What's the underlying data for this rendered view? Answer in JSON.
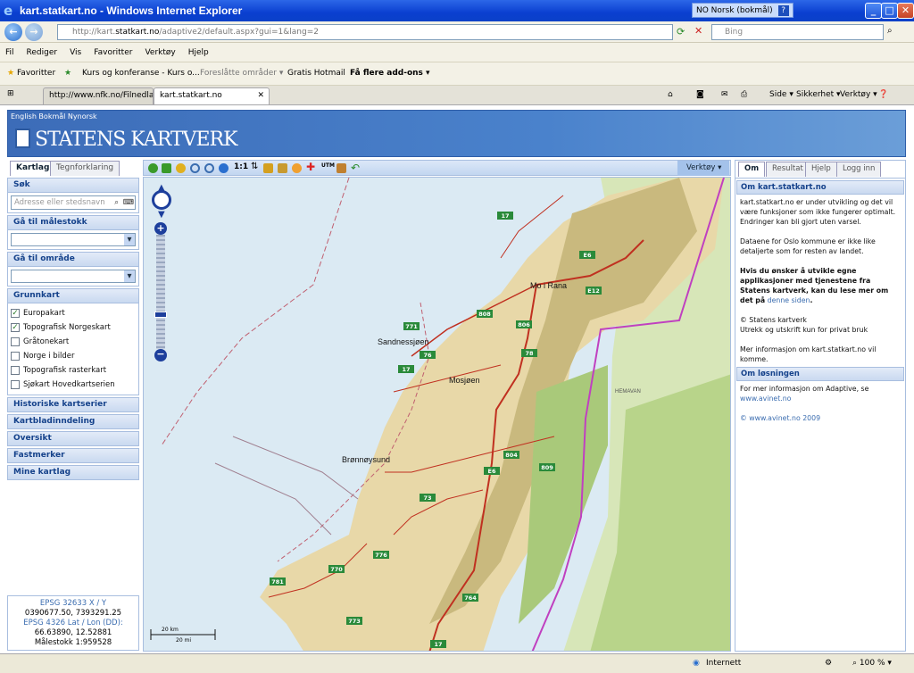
{
  "window": {
    "title_prefix": "kart.statkart.no",
    "title_suffix": "- Windows Internet Explorer",
    "language_indicator": "NO Norsk (bokmål)"
  },
  "address": {
    "url_prefix": "http://kart.",
    "url_domain": "statkart.no",
    "url_path": "/adaptive2/default.aspx?gui=1&lang=2",
    "search_placeholder": "Bing"
  },
  "menu": [
    "Fil",
    "Rediger",
    "Vis",
    "Favoritter",
    "Verktøy",
    "Hjelp"
  ],
  "favorites": {
    "favorites_label": "Favoritter",
    "items": [
      "Kurs og konferanse - Kurs o...",
      "Foreslåtte områder ▾",
      "Gratis Hotmail",
      "Få flere add-ons ▾"
    ]
  },
  "tabs": {
    "tab1": "http://www.nfk.no/Filnedlast...",
    "tab2": "kart.statkart.no",
    "tools": [
      "Side ▾",
      "Sikkerhet ▾",
      "Verktøy ▾"
    ]
  },
  "header": {
    "languages": "English Bokmål Nynorsk",
    "brand": "STATENS KARTVERK"
  },
  "left": {
    "tab_active": "Kartlag",
    "tab_other": "Tegnforklaring",
    "search_title": "Søk",
    "search_placeholder": "Adresse eller stedsnavn",
    "scale_title": "Gå til målestokk",
    "area_title": "Gå til område",
    "basemap_title": "Grunnkart",
    "layers": [
      {
        "label": "Europakart",
        "checked": "✓"
      },
      {
        "label": "Topografisk Norgeskart",
        "checked": "✓"
      },
      {
        "label": "Gråtonekart",
        "checked": ""
      },
      {
        "label": "Norge i bilder",
        "checked": ""
      },
      {
        "label": "Topografisk rasterkart",
        "checked": ""
      },
      {
        "label": "Sjøkart Hovedkartserien",
        "checked": ""
      }
    ],
    "sections": [
      "Historiske kartserier",
      "Kartbladinndeling",
      "Oversikt",
      "Fastmerker",
      "Mine kartlag"
    ]
  },
  "coords": {
    "line1": "EPSG 32633 X / Y",
    "line2": "0390677.50, 7393291.25",
    "line3": "EPSG 4326 Lat / Lon (DD):",
    "line4": "66.63890, 12.52881",
    "line5": "Målestokk 1:959528"
  },
  "maptool": {
    "verktoy": "Verktøy ▾"
  },
  "map": {
    "places": [
      "Mo i Rana",
      "Sandnessjøen",
      "Mosjøen",
      "Brønnøysund",
      "HEMAVAN"
    ],
    "roads": [
      "17",
      "E6",
      "E12",
      "808",
      "806",
      "78",
      "76",
      "73",
      "804",
      "809",
      "771",
      "770",
      "781",
      "776",
      "773",
      "764",
      "17",
      "17",
      "E6"
    ],
    "scale_km": "20 km",
    "scale_mi": "20 mi"
  },
  "right": {
    "tabs": [
      "Om",
      "Resultat",
      "Hjelp",
      "Logg inn"
    ],
    "about_title": "Om kart.statkart.no",
    "about_p1": "kart.statkart.no er under utvikling og det vil være funksjoner som ikke fungerer optimalt. Endringer kan bli gjort uten varsel.",
    "about_p2": "Dataene for Oslo kommune er ikke like detaljerte som for resten av landet.",
    "about_p3_bold": "Hvis du ønsker å utvikle egne applikasjoner med tjenestene fra Statens kartverk, kan du lese mer om det på",
    "about_p3_link": "denne siden",
    "about_p4": "© Statens kartverk",
    "about_p5": "Utrekk og utskrift kun for privat bruk",
    "about_p6": "Mer informasjon om kart.statkart.no vil komme.",
    "solution_title": "Om løsningen",
    "solution_p1": "For mer informasjon om Adaptive, se",
    "solution_link": "www.avinet.no",
    "solution_copy": "© www.avinet.no 2009"
  },
  "status": {
    "zone": "Internett",
    "zoom": "100 %"
  }
}
